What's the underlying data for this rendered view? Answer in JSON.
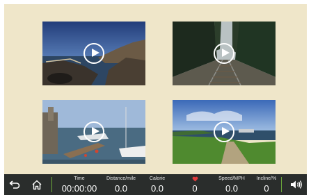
{
  "videos": [
    {
      "scene": "rocky-coast-sunset"
    },
    {
      "scene": "forest-railway-track"
    },
    {
      "scene": "marina-boats-pier"
    },
    {
      "scene": "lakeside-path-park"
    }
  ],
  "footer": {
    "stats": {
      "time": {
        "label": "Time",
        "value": "00:00:00"
      },
      "distance": {
        "label": "Distance/mile",
        "value": "0.0"
      },
      "calorie": {
        "label": "Calorie",
        "value": "0.0"
      },
      "heart_rate": {
        "icon": "heart-icon",
        "value": "0"
      },
      "speed": {
        "label": "Speed/MPH",
        "value": "0.0"
      },
      "incline": {
        "label": "Incline/%",
        "value": "0"
      }
    },
    "icons": {
      "back": "back-arrow-icon",
      "home": "home-icon",
      "volume": "volume-icon"
    }
  },
  "colors": {
    "background": "#efe6c9",
    "footer": "#2a2d2c",
    "separator": "#6fae3c",
    "heart": "#e23b3b"
  }
}
